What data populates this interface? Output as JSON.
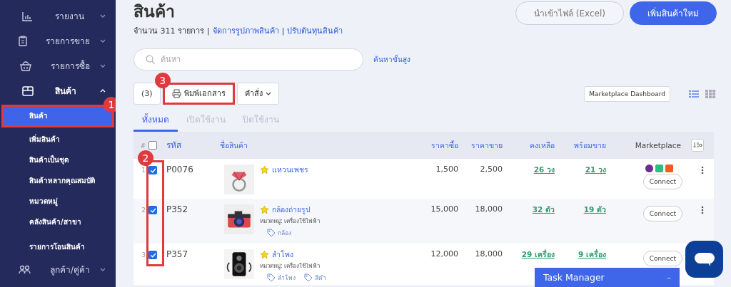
{
  "sidebar": {
    "items": [
      {
        "label": "รายงาน",
        "expanded": false
      },
      {
        "label": "รายการขาย",
        "expanded": false
      },
      {
        "label": "รายการซื้อ",
        "expanded": false
      },
      {
        "label": "สินค้า",
        "expanded": true,
        "children": [
          {
            "label": "สินค้า",
            "selected": true,
            "callout": "1"
          },
          {
            "label": "เพิ่มสินค้า",
            "selected": false
          },
          {
            "label": "สินค้าเป็นชุด",
            "selected": false
          },
          {
            "label": "สินค้าหลากคุณสมบัติ",
            "selected": false
          },
          {
            "label": "หมวดหมู่",
            "selected": false
          },
          {
            "label": "คลังสินค้า/สาขา",
            "selected": false
          },
          {
            "label": "รายการโอนสินค้า",
            "selected": false
          }
        ]
      },
      {
        "label": "ลูกค้า/คู่ค้า",
        "expanded": false
      }
    ]
  },
  "page": {
    "title": "สินค้า",
    "count": "จำนวน 311 รายการ",
    "separator": "|",
    "links": [
      "จัดการรูปภาพสินค้า",
      "ปรับต้นทุนสินค้า"
    ],
    "buttons": [
      {
        "label": "นำเข้าไฟล์ (Excel)",
        "kind": "secondary"
      },
      {
        "label": "เพิ่มสินค้าใหม่",
        "kind": "primary"
      }
    ]
  },
  "search": {
    "placeholder": "ค้นหา",
    "advanced": "ค้นหาขั้นสูง"
  },
  "toolbar": {
    "selected_count": "(3)",
    "print": {
      "label": "พิมพ์เอกสาร",
      "callout": "3"
    },
    "command": "คำสั่ง",
    "dashboard": "Marketplace Dashboard",
    "views": [
      {
        "kind": "list",
        "selected": true
      },
      {
        "kind": "grid",
        "selected": false
      }
    ]
  },
  "tabs": [
    {
      "label": "ทั้งหมด",
      "selected": true
    },
    {
      "label": "เปิดใช้งาน",
      "selected": false
    },
    {
      "label": "ปิดใช้งาน",
      "selected": false
    }
  ],
  "table": {
    "columns": [
      "#",
      "รหัส",
      "ชื่อสินค้า",
      "ราคาซื้อ",
      "ราคาขาย",
      "คงเหลือ",
      "พร้อมขาย",
      "Marketplace"
    ],
    "all_checked": false,
    "checkbox_callout": "2",
    "rows": [
      {
        "index": "1",
        "checked": true,
        "code": "P0076",
        "name": "แหวนเพชร",
        "starred": true,
        "tags": [],
        "buy": "1,500",
        "sell": "2,500",
        "stock": "26 วง",
        "ready": "21 วง",
        "marketplaces": [
          {
            "color": "#6b2d8f"
          },
          {
            "color": "#2bbf80"
          },
          {
            "color": "#f15a22"
          }
        ],
        "connect": "Connect",
        "menu": true
      },
      {
        "index": "2",
        "checked": true,
        "code": "P352",
        "name": "กล้องถ่ายรูป",
        "starred": true,
        "category": "หมวดหมู่: เครื่องใช้ไฟฟ้า",
        "tags": [
          "กล้อง"
        ],
        "buy": "15,000",
        "sell": "18,000",
        "stock": "32 ตัว",
        "ready": "19 ตัว",
        "marketplaces": [],
        "connect": "Connect",
        "menu": true
      },
      {
        "index": "3",
        "checked": true,
        "code": "P357",
        "name": "ลำโพง",
        "starred": true,
        "category": "หมวดหมู่: เครื่องใช้ไฟฟ้า",
        "tags": [
          "ลำโพง",
          "สีดำ"
        ],
        "buy": "12,000",
        "sell": "18,000",
        "stock": "29 เครื่อง",
        "ready": "9 เครื่อง",
        "marketplaces": [],
        "connect": "Connect",
        "menu": false
      }
    ]
  },
  "task_manager": {
    "title": "Task Manager",
    "minimize": "–"
  }
}
